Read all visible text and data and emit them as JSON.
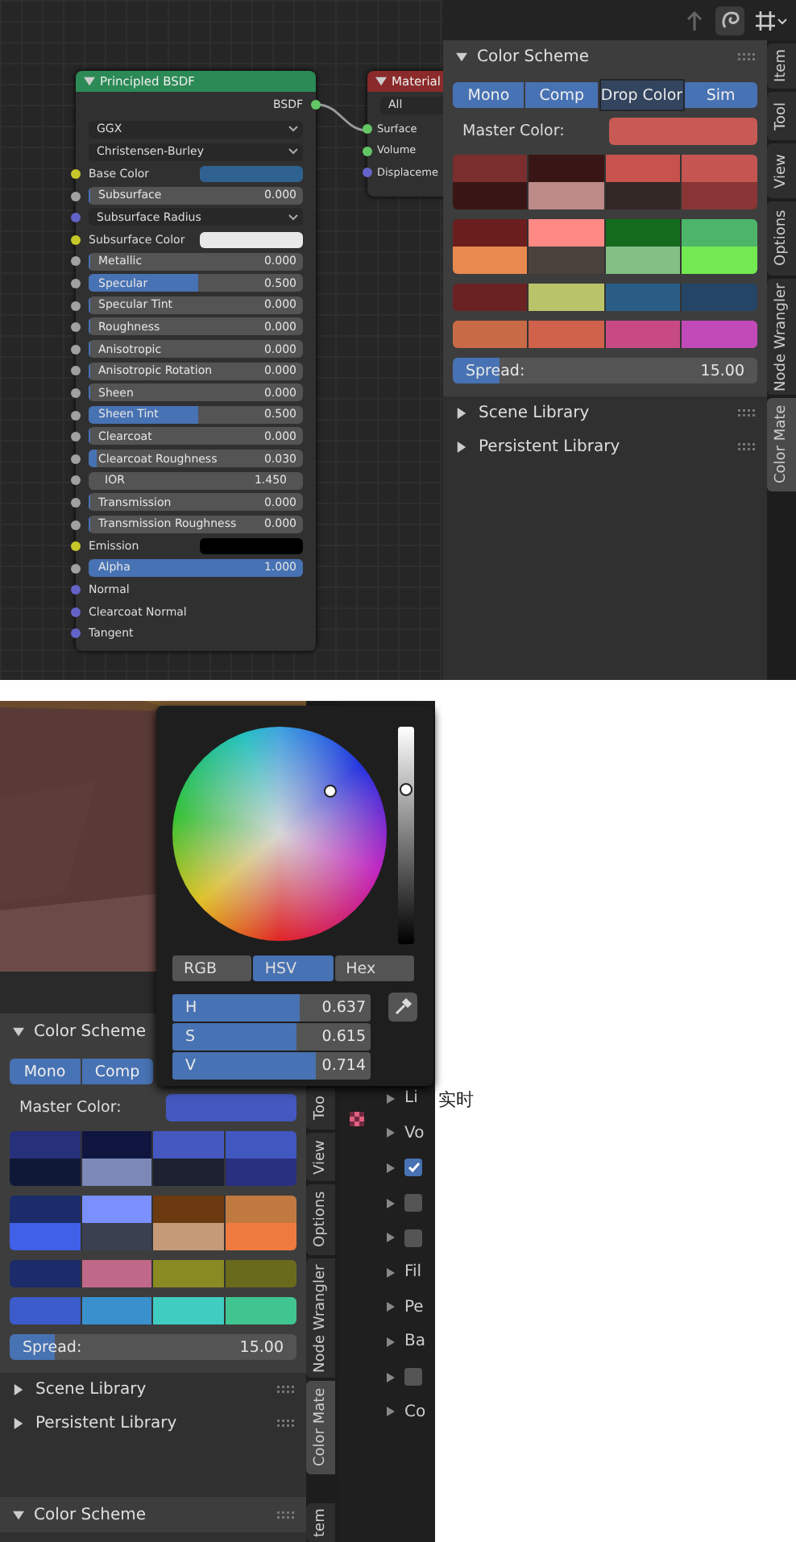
{
  "top": {
    "bsdf_node": {
      "title": "Principled BSDF",
      "output": "BSDF",
      "dropdowns": [
        "GGX",
        "Christensen-Burley"
      ],
      "inputs": [
        {
          "kind": "color",
          "label": "Base Color",
          "swatch": {
            "color": "#2f6290"
          },
          "color": "#c7c729"
        },
        {
          "kind": "slider",
          "label": "Subsurface",
          "value": "0.000",
          "level": 0,
          "color": "#a1a1a1"
        },
        {
          "kind": "dropdown",
          "label": "Subsurface Radius",
          "color": "#6363c7"
        },
        {
          "kind": "color",
          "label": "Subsurface Color",
          "swatch": {
            "color": "#e8e8e8"
          },
          "color": "#c7c729"
        },
        {
          "kind": "slider",
          "label": "Metallic",
          "value": "0.000",
          "level": 0,
          "color": "#a1a1a1"
        },
        {
          "kind": "slider",
          "label": "Specular",
          "value": "0.500",
          "level": 0.5,
          "color": "#a1a1a1"
        },
        {
          "kind": "slider",
          "label": "Specular Tint",
          "value": "0.000",
          "level": 0,
          "color": "#a1a1a1"
        },
        {
          "kind": "slider",
          "label": "Roughness",
          "value": "0.000",
          "level": 0,
          "color": "#a1a1a1"
        },
        {
          "kind": "slider",
          "label": "Anisotropic",
          "value": "0.000",
          "level": 0,
          "color": "#a1a1a1"
        },
        {
          "kind": "slider",
          "label": "Anisotropic Rotation",
          "value": "0.000",
          "level": 0,
          "color": "#a1a1a1"
        },
        {
          "kind": "slider",
          "label": "Sheen",
          "value": "0.000",
          "level": 0,
          "color": "#a1a1a1"
        },
        {
          "kind": "slider",
          "label": "Sheen Tint",
          "value": "0.500",
          "level": 0.5,
          "color": "#a1a1a1"
        },
        {
          "kind": "slider",
          "label": "Clearcoat",
          "value": "0.000",
          "level": 0,
          "color": "#a1a1a1"
        },
        {
          "kind": "slider",
          "label": "Clearcoat Roughness",
          "value": "0.030",
          "level": 0.03,
          "color": "#a1a1a1"
        },
        {
          "kind": "number",
          "label": "IOR",
          "value": "1.450",
          "color": "#a1a1a1"
        },
        {
          "kind": "slider",
          "label": "Transmission",
          "value": "0.000",
          "level": 0,
          "color": "#a1a1a1"
        },
        {
          "kind": "slider",
          "label": "Transmission Roughness",
          "value": "0.000",
          "level": 0,
          "color": "#a1a1a1"
        },
        {
          "kind": "color",
          "label": "Emission",
          "swatch": {
            "color": "#000000"
          },
          "color": "#c7c729"
        },
        {
          "kind": "slider",
          "label": "Alpha",
          "value": "1.000",
          "level": 1,
          "color": "#a1a1a1"
        },
        {
          "kind": "plain",
          "label": "Normal",
          "color": "#6363c7"
        },
        {
          "kind": "plain",
          "label": "Clearcoat Normal",
          "color": "#6363c7"
        },
        {
          "kind": "plain",
          "label": "Tangent",
          "color": "#6363c7"
        }
      ]
    },
    "output_node": {
      "title": "Material",
      "target": "All",
      "inputs": [
        {
          "label": "Surface",
          "color": "#63c763"
        },
        {
          "label": "Volume",
          "color": "#63c763"
        },
        {
          "label": "Displaceme",
          "color": "#6363c7"
        }
      ]
    },
    "panel": {
      "header": "Color Scheme",
      "expanded": true,
      "modes": [
        "Mono",
        "Comp",
        "Sim"
      ],
      "drag_label": "Drop Color",
      "master": {
        "label": "Master Color:",
        "swatch": {
          "color": "#c85a55"
        }
      },
      "groups": [
        [
          [
            {
              "color": "#7a2e2e"
            },
            {
              "color": "#3a1515"
            },
            {
              "color": "#c8524d"
            },
            {
              "color": "#c55550"
            }
          ],
          [
            {
              "color": "#3a1515"
            },
            {
              "color": "#bd8a88"
            },
            {
              "color": "#332725"
            },
            {
              "color": "#8a3535"
            }
          ]
        ],
        [
          [
            {
              "color": "#6b1e1e"
            },
            {
              "color": "#ff8a85"
            },
            {
              "color": "#146b1e"
            },
            {
              "color": "#4cb56a"
            }
          ],
          [
            {
              "color": "#e8894f"
            },
            {
              "color": "#4a423c"
            },
            {
              "color": "#84bf86"
            },
            {
              "color": "#72e851"
            }
          ]
        ],
        [
          [
            {
              "color": "#6b2222"
            },
            {
              "color": "#b9c46a"
            },
            {
              "color": "#2a5d86"
            },
            {
              "color": "#244566"
            }
          ]
        ],
        [
          [
            {
              "color": "#c86a45"
            },
            {
              "color": "#d0614a"
            },
            {
              "color": "#c74a85"
            },
            {
              "color": "#c24ab8"
            }
          ]
        ]
      ],
      "spread": {
        "label": "Spread:",
        "value": "15.00",
        "level": 0.15
      },
      "sections": [
        {
          "label": "Scene Library",
          "expanded": false
        },
        {
          "label": "Persistent Library",
          "expanded": false
        }
      ]
    },
    "tabs": [
      {
        "label": "Item",
        "selected": false
      },
      {
        "label": "Tool",
        "selected": false
      },
      {
        "label": "View",
        "selected": false
      },
      {
        "label": "Options",
        "selected": false
      },
      {
        "label": "Node Wrangler",
        "selected": false
      },
      {
        "label": "Color Mate",
        "selected": true
      }
    ]
  },
  "bottom": {
    "picker": {
      "modes": [
        {
          "label": "RGB",
          "selected": false
        },
        {
          "label": "HSV",
          "selected": true
        },
        {
          "label": "Hex",
          "selected": false
        }
      ],
      "fields": [
        {
          "label": "H",
          "value": "0.637",
          "level": 0.637
        },
        {
          "label": "S",
          "value": "0.615",
          "level": 0.615
        },
        {
          "label": "V",
          "value": "0.714",
          "level": 0.714
        }
      ]
    },
    "panel": {
      "header": "Color Scheme",
      "expanded": true,
      "modes": [
        "Mono",
        "Comp"
      ],
      "master": {
        "label": "Master Color:",
        "swatch": {
          "color": "#4458c0"
        }
      },
      "groups": [
        [
          [
            {
              "color": "#27307a"
            },
            {
              "color": "#101540"
            },
            {
              "color": "#4458c0"
            },
            {
              "color": "#4058c0"
            }
          ],
          [
            {
              "color": "#101838"
            },
            {
              "color": "#7b88b8"
            },
            {
              "color": "#1c2030"
            },
            {
              "color": "#2a3080"
            }
          ]
        ],
        [
          [
            {
              "color": "#1c2c6a"
            },
            {
              "color": "#7a90ff"
            },
            {
              "color": "#6b3a10"
            },
            {
              "color": "#c07a40"
            }
          ],
          [
            {
              "color": "#4060e8"
            },
            {
              "color": "#3a4050"
            },
            {
              "color": "#c49a78"
            },
            {
              "color": "#ef7a40"
            }
          ]
        ],
        [
          [
            {
              "color": "#1c2c6a"
            },
            {
              "color": "#c06888"
            },
            {
              "color": "#8a8a22"
            },
            {
              "color": "#6a6a1c"
            }
          ]
        ],
        [
          [
            {
              "color": "#3c5ccc"
            },
            {
              "color": "#3a90cc"
            },
            {
              "color": "#40ccc0"
            },
            {
              "color": "#40c490"
            }
          ]
        ]
      ],
      "spread": {
        "label": "Spread:",
        "value": "15.00",
        "level": 0.15
      },
      "sections": [
        {
          "label": "Scene Library",
          "expanded": false
        },
        {
          "label": "Persistent Library",
          "expanded": false
        }
      ]
    },
    "tabs": [
      {
        "label": "Too",
        "selected": false
      },
      {
        "label": "View",
        "selected": false
      },
      {
        "label": "Options",
        "selected": false
      },
      {
        "label": "Node Wrangler",
        "selected": false
      },
      {
        "label": "Color Mate",
        "selected": true
      }
    ],
    "properties": [
      {
        "kind": "text",
        "label": "Li"
      },
      {
        "kind": "text",
        "label": "Vo"
      },
      {
        "kind": "check",
        "checked": true
      },
      {
        "kind": "check",
        "checked": false
      },
      {
        "kind": "check",
        "checked": false
      },
      {
        "kind": "text",
        "label": "Fil"
      },
      {
        "kind": "text",
        "label": "Pe"
      },
      {
        "kind": "text",
        "label": "Ba"
      },
      {
        "kind": "check",
        "checked": false
      },
      {
        "kind": "text",
        "label": "Co"
      }
    ],
    "overlay_text": "实时",
    "next_panel": {
      "header": "Color Scheme",
      "expanded": true
    },
    "next_tab": "tem"
  }
}
